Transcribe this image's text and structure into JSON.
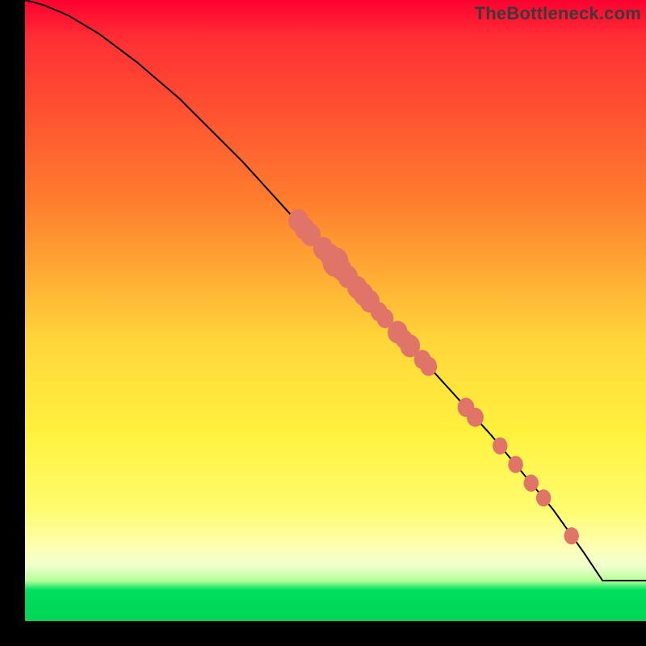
{
  "watermark": "TheBottleneck.com",
  "colors": {
    "marker": "#e07468",
    "line": "#000000",
    "frame": "#000000"
  },
  "chart_data": {
    "type": "line",
    "title": "",
    "xlabel": "",
    "ylabel": "",
    "xlim": [
      0,
      100
    ],
    "ylim": [
      0,
      100
    ],
    "axes_visible": false,
    "grid": false,
    "series": [
      {
        "name": "curve",
        "x": [
          0,
          3,
          7,
          12,
          18,
          25,
          35,
          45,
          55,
          65,
          75,
          85,
          90,
          93,
          100
        ],
        "y": [
          100,
          99.2,
          97.5,
          94.5,
          90,
          84,
          74,
          63,
          52,
          41,
          30,
          18,
          11,
          6.5,
          6.5
        ]
      }
    ],
    "markers": [
      {
        "x": 44,
        "y": 64.5,
        "r": 1.6
      },
      {
        "x": 45,
        "y": 63.2,
        "r": 1.6
      },
      {
        "x": 46,
        "y": 62.2,
        "r": 1.6
      },
      {
        "x": 48,
        "y": 60.0,
        "r": 1.6
      },
      {
        "x": 49,
        "y": 59.0,
        "r": 1.6
      },
      {
        "x": 50,
        "y": 57.8,
        "r": 2.1
      },
      {
        "x": 51,
        "y": 56.6,
        "r": 1.6
      },
      {
        "x": 52,
        "y": 55.4,
        "r": 1.6
      },
      {
        "x": 53.5,
        "y": 53.7,
        "r": 1.6
      },
      {
        "x": 54.5,
        "y": 52.6,
        "r": 1.6
      },
      {
        "x": 55.5,
        "y": 51.5,
        "r": 1.6
      },
      {
        "x": 57,
        "y": 49.8,
        "r": 1.35
      },
      {
        "x": 58,
        "y": 48.7,
        "r": 1.35
      },
      {
        "x": 60,
        "y": 46.5,
        "r": 1.6
      },
      {
        "x": 61,
        "y": 45.4,
        "r": 1.35
      },
      {
        "x": 62,
        "y": 44.3,
        "r": 1.6
      },
      {
        "x": 64,
        "y": 42.1,
        "r": 1.35
      },
      {
        "x": 65,
        "y": 41.0,
        "r": 1.35
      },
      {
        "x": 71,
        "y": 34.4,
        "r": 1.35
      },
      {
        "x": 72.5,
        "y": 32.8,
        "r": 1.35
      },
      {
        "x": 76.5,
        "y": 28.2,
        "r": 1.2
      },
      {
        "x": 79,
        "y": 25.2,
        "r": 1.2
      },
      {
        "x": 81.5,
        "y": 22.2,
        "r": 1.2
      },
      {
        "x": 83.5,
        "y": 19.8,
        "r": 1.2
      },
      {
        "x": 88,
        "y": 13.7,
        "r": 1.2
      }
    ]
  }
}
